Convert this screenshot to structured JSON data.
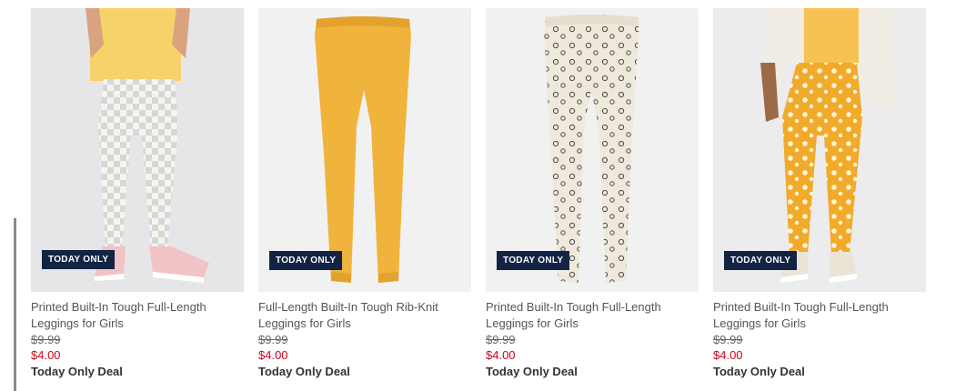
{
  "products": [
    {
      "badge": "TODAY ONLY",
      "name": "Printed Built-In Tough Full-Length Leggings for Girls",
      "original_price": "$9.99",
      "sale_price": "$4.00",
      "deal_label": "Today Only Deal",
      "image_desc": "girl-wearing-checkered-leggings"
    },
    {
      "badge": "TODAY ONLY",
      "name": "Full-Length Built-In Tough Rib-Knit Leggings for Girls",
      "original_price": "$9.99",
      "sale_price": "$4.00",
      "deal_label": "Today Only Deal",
      "image_desc": "yellow-rib-knit-leggings-flat"
    },
    {
      "badge": "TODAY ONLY",
      "name": "Printed Built-In Tough Full-Length Leggings for Girls",
      "original_price": "$9.99",
      "sale_price": "$4.00",
      "deal_label": "Today Only Deal",
      "image_desc": "cream-printed-leggings-flat"
    },
    {
      "badge": "TODAY ONLY",
      "name": "Printed Built-In Tough Full-Length Leggings for Girls",
      "original_price": "$9.99",
      "sale_price": "$4.00",
      "deal_label": "Today Only Deal",
      "image_desc": "girl-wearing-yellow-floral-leggings"
    }
  ],
  "colors": {
    "badge_bg": "#122344",
    "sale_price": "#d0021b",
    "legging_yellow": "#f0b33c",
    "floral_yellow": "#f2aa2a"
  }
}
